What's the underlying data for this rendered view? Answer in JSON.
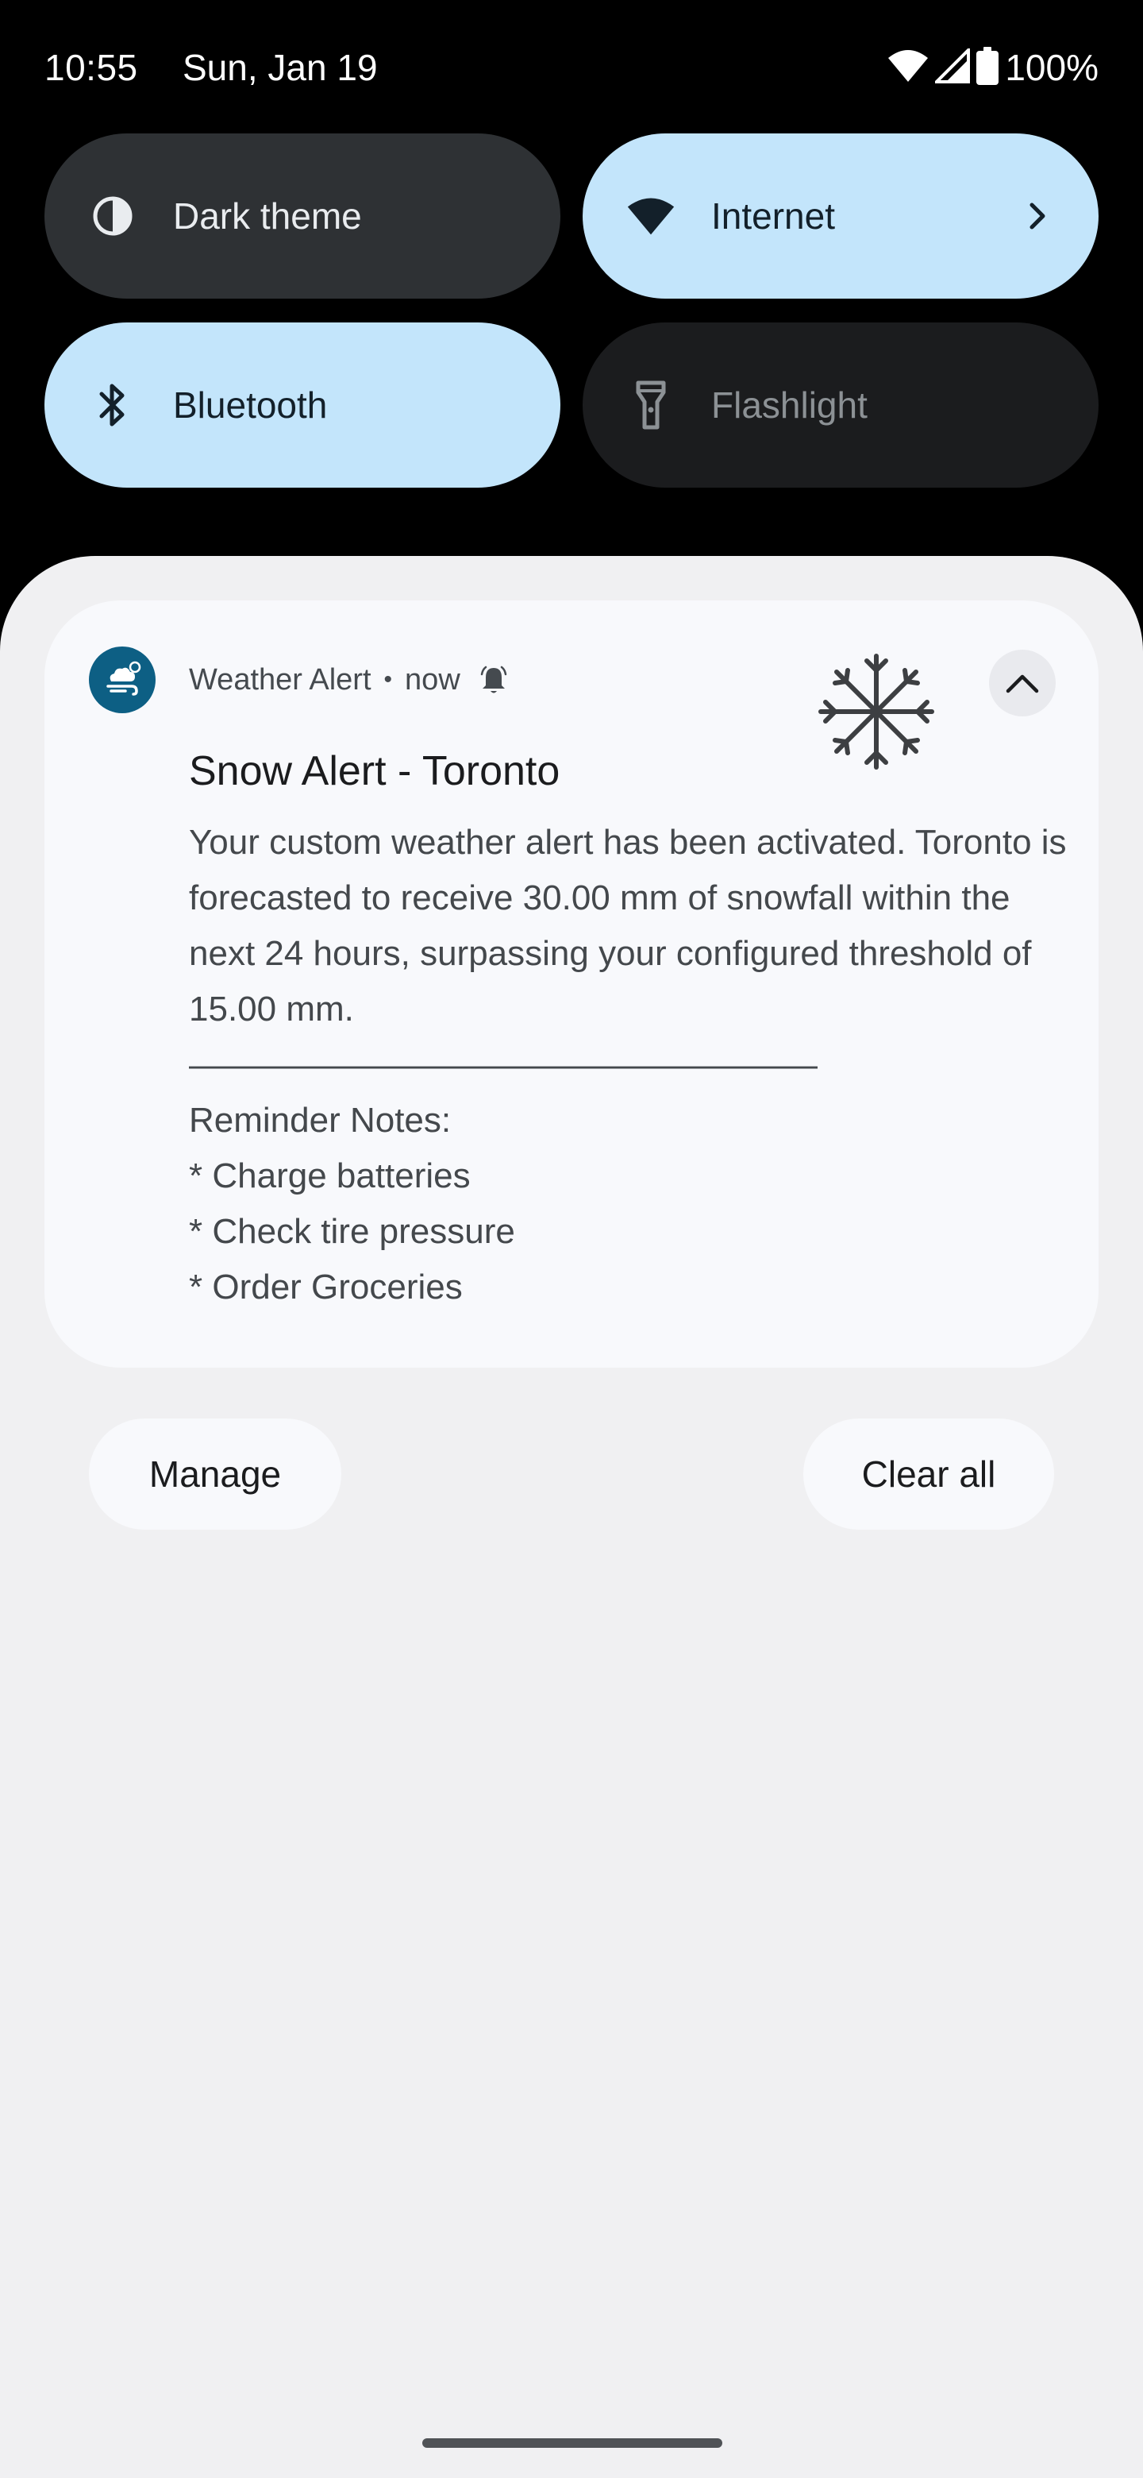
{
  "status_bar": {
    "time": "10:55",
    "date": "Sun, Jan 19",
    "battery_percent": "100%",
    "wifi_icon": "wifi-icon",
    "signal_icon": "cell-signal-icon",
    "battery_icon": "battery-full-icon"
  },
  "quick_settings": {
    "tiles": [
      {
        "label": "Dark theme",
        "icon": "dark-theme-icon",
        "active": false
      },
      {
        "label": "Internet",
        "icon": "wifi-icon",
        "active": true
      },
      {
        "label": "Bluetooth",
        "icon": "bluetooth-icon",
        "active": true
      },
      {
        "label": "Flashlight",
        "icon": "flashlight-icon",
        "active": false
      }
    ]
  },
  "notification": {
    "app_name": "Weather Alert",
    "separator": "•",
    "time": "now",
    "title": "Snow Alert - Toronto",
    "body": "Your custom weather alert has been activated. Toronto is forecasted to receive 30.00 mm of snowfall within the next 24 hours, surpassing your configured threshold of 15.00 mm.\n——————————————————\nReminder Notes:\n* Charge batteries\n* Check tire pressure\n* Order Groceries"
  },
  "actions": {
    "manage": "Manage",
    "clear_all": "Clear all"
  },
  "colors": {
    "active_tile": "#c3e5fb",
    "inactive_tile": "#2e3134",
    "shade_background": "#f0f0f2",
    "app_icon": "#0d5f84"
  }
}
